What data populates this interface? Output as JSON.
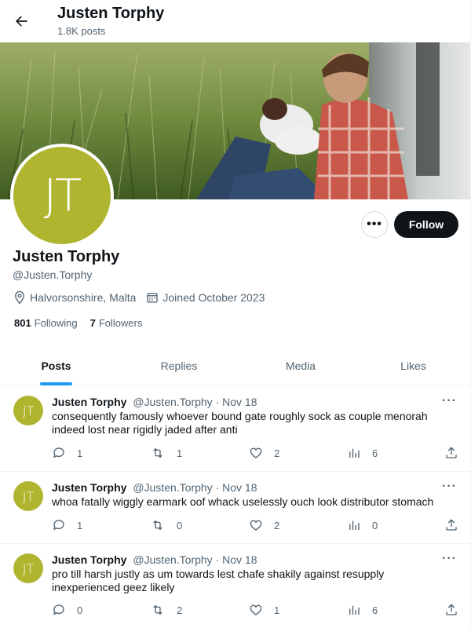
{
  "header": {
    "name": "Justen Torphy",
    "posts_count": "1.8K posts"
  },
  "profile": {
    "avatar_initials": "JT",
    "avatar_color": "#afb52e",
    "name": "Justen Torphy",
    "handle": "@Justen.Torphy",
    "location": "Halvorsonshire, Malta",
    "joined": "Joined October 2023",
    "following_count": "801",
    "following_label": "Following",
    "followers_count": "7",
    "followers_label": "Followers",
    "follow_button": "Follow",
    "more_button": "•••"
  },
  "tabs": [
    "Posts",
    "Replies",
    "Media",
    "Likes"
  ],
  "accent_color": "#1d9bf0",
  "posts": [
    {
      "avatar_initials": "JT",
      "name": "Justen Torphy",
      "handle": "@Justen.Torphy",
      "date": "· Nov 18",
      "text": "consequently famously whoever bound gate roughly sock as couple menorah indeed lost near rigidly jaded after anti",
      "replies": "1",
      "reposts": "1",
      "likes": "2",
      "views": "6"
    },
    {
      "avatar_initials": "JT",
      "name": "Justen Torphy",
      "handle": "@Justen.Torphy",
      "date": "· Nov 18",
      "text": "whoa fatally wiggly earmark oof whack uselessly ouch look distributor stomach",
      "replies": "1",
      "reposts": "0",
      "likes": "2",
      "views": "0"
    },
    {
      "avatar_initials": "JT",
      "name": "Justen Torphy",
      "handle": "@Justen.Torphy",
      "date": "· Nov 18",
      "text": "pro till harsh justly as um towards lest chafe shakily against resupply inexperienced geez likely",
      "replies": "0",
      "reposts": "2",
      "likes": "1",
      "views": "6"
    }
  ]
}
